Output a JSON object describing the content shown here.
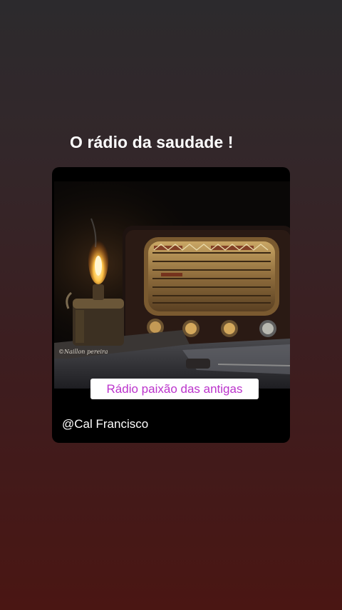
{
  "story": {
    "caption": "O rádio da saudade !",
    "post": {
      "image_description_icon": "vintage-radio-oil-lamp-photo",
      "watermark": "©Naillon pereira",
      "badge_text": "Rádio paixão das antigas",
      "username": "@Cal Francisco"
    }
  },
  "colors": {
    "background_top": "#2c2a2d",
    "background_bottom": "#4a1613",
    "badge_text": "#bb33cc",
    "card": "#000000"
  }
}
